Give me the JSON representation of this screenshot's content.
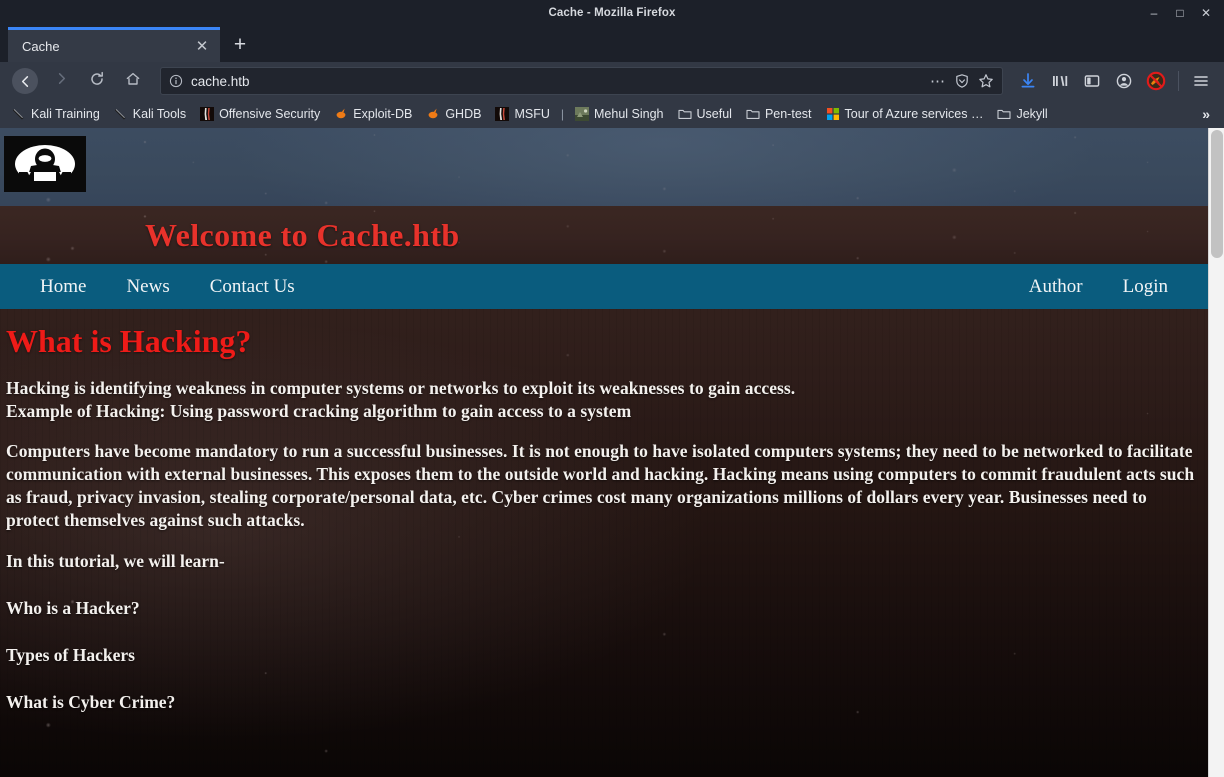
{
  "window": {
    "title": "Cache - Mozilla Firefox",
    "controls": {
      "minimize": "–",
      "maximize": "□",
      "close": "✕"
    }
  },
  "tabs": {
    "active": {
      "label": "Cache",
      "close_label": "✕"
    },
    "new_tab_label": "+"
  },
  "toolbar": {
    "back_label": "←",
    "forward_label": "→",
    "reload_label": "↻",
    "home_label": "⌂",
    "url": "cache.htb",
    "url_info_label": "ⓘ",
    "page_actions_label": "⋯",
    "icons": {
      "downloads": "downloads-icon",
      "library": "library-icon",
      "sidebar": "sidebar-icon",
      "account": "account-icon",
      "noscript": "noscript-icon",
      "menu": "hamburger-menu-icon"
    }
  },
  "bookmarks": {
    "items": [
      {
        "label": "Kali Training",
        "icon": "kali-dragon-icon"
      },
      {
        "label": "Kali Tools",
        "icon": "kali-dragon-icon"
      },
      {
        "label": "Offensive Security",
        "icon": "offsec-icon"
      },
      {
        "label": "Exploit-DB",
        "icon": "exploitdb-icon"
      },
      {
        "label": "GHDB",
        "icon": "exploitdb-icon"
      },
      {
        "label": "MSFU",
        "icon": "offsec-icon"
      },
      {
        "label": "Mehul Singh",
        "icon": "photo-favicon-icon"
      },
      {
        "label": "Useful",
        "icon": "folder-icon"
      },
      {
        "label": "Pen-test",
        "icon": "folder-icon"
      },
      {
        "label": "Tour of Azure services …",
        "icon": "azure-icon"
      },
      {
        "label": "Jekyll",
        "icon": "folder-icon"
      }
    ],
    "separator": "|",
    "overflow_label": "»"
  },
  "site": {
    "logo_alt": "hacker-logo",
    "title": "Welcome to Cache.htb",
    "nav_left": [
      {
        "label": "Home"
      },
      {
        "label": "News"
      },
      {
        "label": "Contact Us"
      }
    ],
    "nav_right": [
      {
        "label": "Author"
      },
      {
        "label": "Login"
      }
    ],
    "heading": "What is Hacking?",
    "paragraph_1_line_1": "Hacking is identifying weakness in computer systems or networks to exploit its weaknesses to gain access.",
    "paragraph_1_line_2": "Example of Hacking: Using password cracking algorithm to gain access to a system",
    "paragraph_2": "Computers have become mandatory to run a successful businesses. It is not enough to have isolated computers systems; they need to be networked to facilitate communication with external businesses. This exposes them to the outside world and hacking. Hacking means using computers to commit fraudulent acts such as fraud, privacy invasion, stealing corporate/personal data, etc. Cyber crimes cost many organizations millions of dollars every year. Businesses need to protect themselves against such attacks.",
    "tutorial_lead": "In this tutorial, we will learn-",
    "list_items": [
      "Who is a Hacker?",
      "Types of Hackers",
      "What is Cyber Crime?"
    ]
  },
  "colors": {
    "nav_blue": "#0a5c7e",
    "title_red": "#e8322b",
    "heading_red": "#ee1b18",
    "chrome_bg": "#323844",
    "tab_accent": "#3b85f5"
  }
}
